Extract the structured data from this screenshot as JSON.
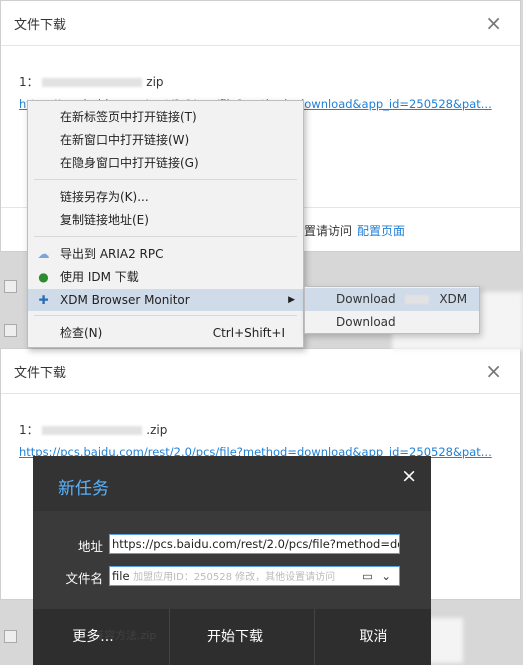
{
  "dialog1": {
    "title": "文件下载",
    "close": "×",
    "file_prefix": "1：",
    "file_suffix": "zip",
    "link": "https://pcs.baidu.com/rest/2.0/pcs/file?method=download&app_id=250528&pat...",
    "footer_text": "置请访问",
    "footer_link": "配置页面"
  },
  "context_menu": {
    "items": [
      {
        "label": "在新标签页中打开链接(T)"
      },
      {
        "label": "在新窗口中打开链接(W)"
      },
      {
        "label": "在隐身窗口中打开链接(G)"
      },
      {
        "label": "链接另存为(K)..."
      },
      {
        "label": "复制链接地址(E)"
      },
      {
        "label": "导出到 ARIA2 RPC",
        "icon": "cloud-icon"
      },
      {
        "label": "使用 IDM 下载",
        "icon": "idm-globe-icon"
      },
      {
        "label": "XDM Browser Monitor",
        "icon": "xdm-icon",
        "submenu": "▶"
      },
      {
        "label": "检查(N)",
        "shortcut": "Ctrl+Shift+I"
      }
    ],
    "submenu": [
      {
        "label": "Download",
        "suffix": "XDM"
      },
      {
        "label": "Download"
      }
    ]
  },
  "dialog2": {
    "title": "文件下载",
    "close": "×",
    "file_prefix": "1：",
    "file_suffix": ".zip",
    "link": "https://pcs.baidu.com/rest/2.0/pcs/file?method=download&app_id=250528&pat..."
  },
  "task": {
    "title": "新任务",
    "close": "×",
    "address_label": "地址",
    "address_value": "https://pcs.baidu.com/rest/2.0/pcs/file?method=down",
    "filename_label": "文件名",
    "filename_value": "file",
    "filename_overlay": "加盟应用ID：250528 修改，其他设置请访问",
    "btn_more": "更多...",
    "btn_start": "开始下载",
    "btn_cancel": "取消",
    "behind_text": "兼容方法.zip"
  }
}
